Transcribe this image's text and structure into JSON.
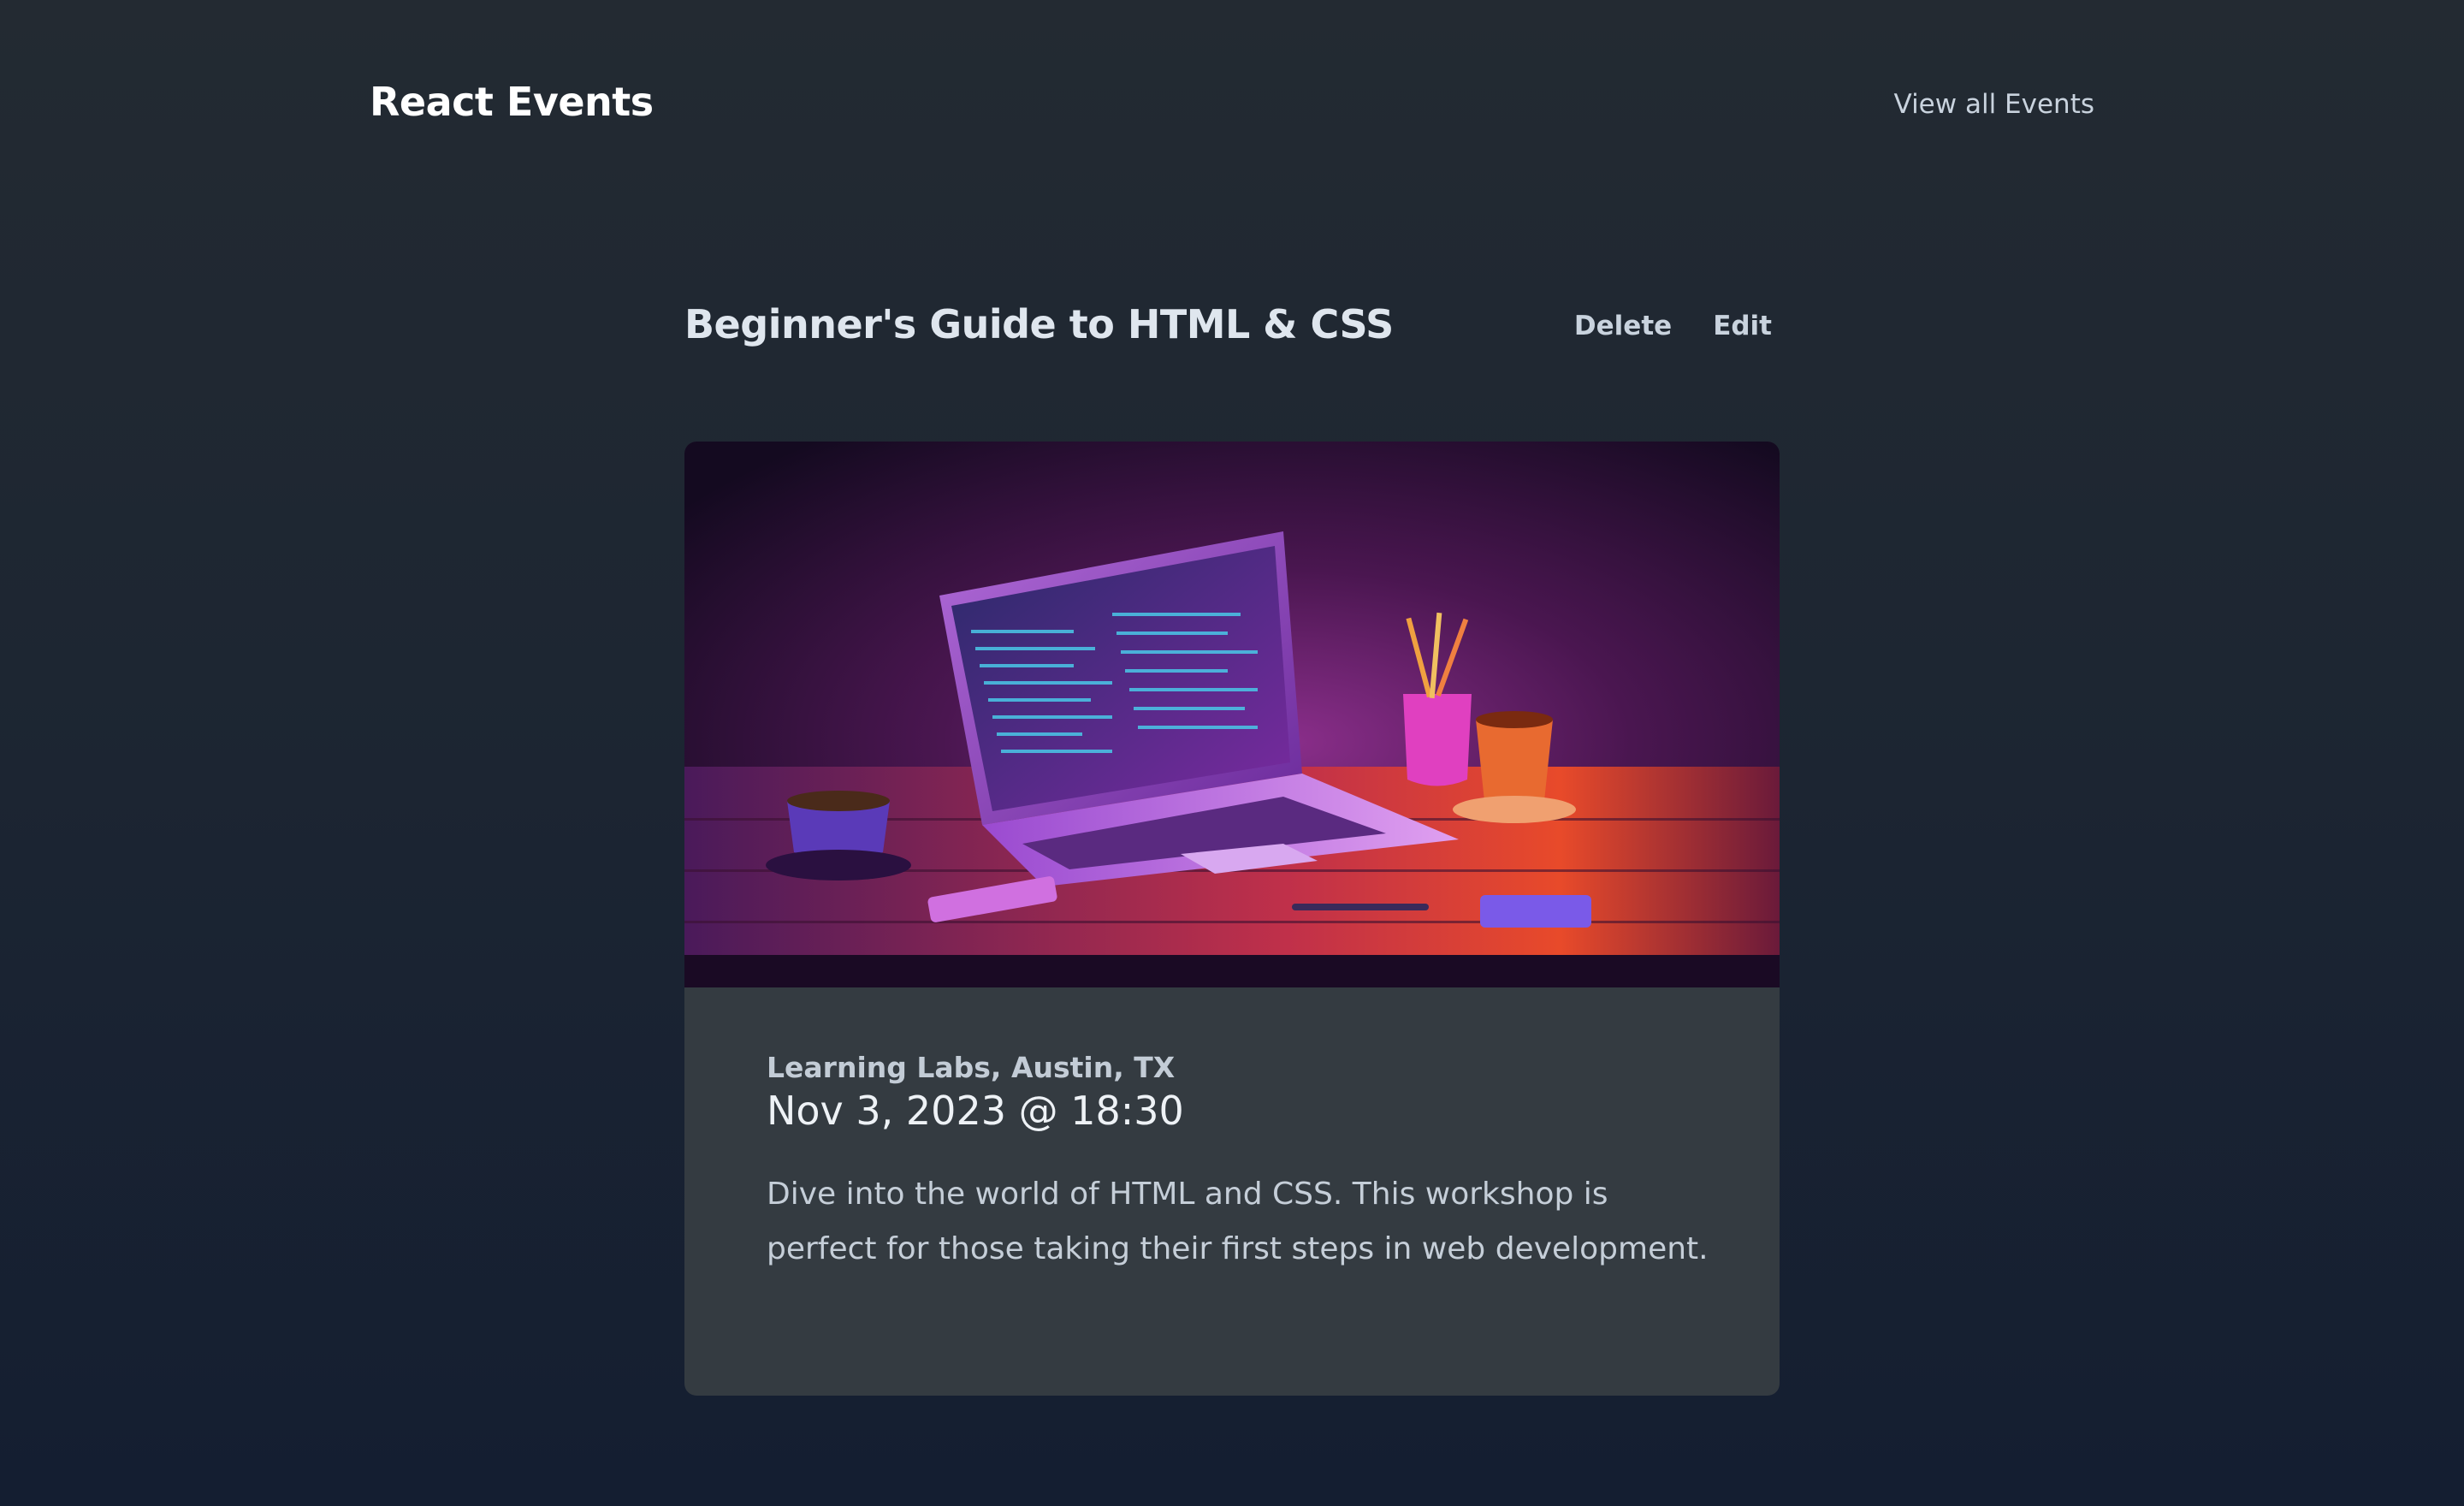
{
  "header": {
    "brand": "React Events",
    "nav_link": "View all Events"
  },
  "event": {
    "title": "Beginner's Guide to HTML & CSS",
    "delete_label": "Delete",
    "edit_label": "Edit",
    "location": "Learning Labs, Austin, TX",
    "datetime": "Nov 3, 2023 @ 18:30",
    "description": "Dive into the world of HTML and CSS. This workshop is perfect for those taking their first steps in web development."
  },
  "colors": {
    "background_top": "#232a32",
    "background_bottom": "#141e31",
    "card_background": "#343b41",
    "heading_text": "#dfe6ee",
    "muted_text": "#c9d3de"
  }
}
